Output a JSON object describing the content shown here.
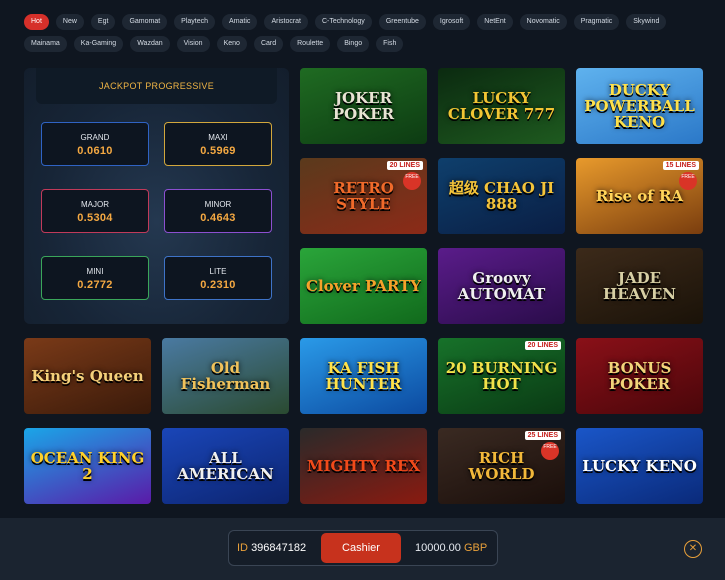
{
  "categories": [
    {
      "label": "Hot",
      "active": true
    },
    {
      "label": "New"
    },
    {
      "label": "Egt"
    },
    {
      "label": "Gamomat"
    },
    {
      "label": "Playtech"
    },
    {
      "label": "Amatic"
    },
    {
      "label": "Aristocrat"
    },
    {
      "label": "C-Technology"
    },
    {
      "label": "Greentube"
    },
    {
      "label": "Igrosoft"
    },
    {
      "label": "NetEnt"
    },
    {
      "label": "Novomatic"
    },
    {
      "label": "Pragmatic"
    },
    {
      "label": "Skywind"
    },
    {
      "label": "Mainama"
    },
    {
      "label": "Ka-Gaming"
    },
    {
      "label": "Wazdan"
    },
    {
      "label": "Vision"
    },
    {
      "label": "Keno"
    },
    {
      "label": "Card"
    },
    {
      "label": "Roulette"
    },
    {
      "label": "Bingo"
    },
    {
      "label": "Fish"
    }
  ],
  "jackpot": {
    "title": "JACKPOT PROGRESSIVE",
    "items": [
      {
        "label": "GRAND",
        "value": "0.0610",
        "border": "#2f63c4"
      },
      {
        "label": "MAXI",
        "value": "0.5969",
        "border": "#d2a73c"
      },
      {
        "label": "MAJOR",
        "value": "0.5304",
        "border": "#c13a5a"
      },
      {
        "label": "MINOR",
        "value": "0.4643",
        "border": "#8c4fd0"
      },
      {
        "label": "MINI",
        "value": "0.2772",
        "border": "#3aa65a"
      },
      {
        "label": "LITE",
        "value": "0.2310",
        "border": "#3e73c8"
      }
    ]
  },
  "games": [
    {
      "name": "JOKER POKER",
      "bg": "linear-gradient(160deg,#1f6b22,#0d3b12)",
      "color": "#e9e4d4"
    },
    {
      "name": "LUCKY CLOVER 777",
      "bg": "linear-gradient(160deg,#0b2a10,#1e5a1f)",
      "color": "#f2c534"
    },
    {
      "name": "DUCKY POWERBALL KENO",
      "bg": "linear-gradient(160deg,#5fb2ee,#2b78c8)",
      "color": "#ffe14a"
    },
    {
      "name": "RETRO STYLE",
      "bg": "linear-gradient(160deg,#5a3a1c,#8c2a18)",
      "color": "#f06a2a",
      "badge": "20 LINES",
      "badge2": "FREE"
    },
    {
      "name": "超级 CHAO JI 888",
      "bg": "linear-gradient(160deg,#0e3f6c,#0a1e44)",
      "color": "#f4c43a"
    },
    {
      "name": "Rise of RA",
      "bg": "linear-gradient(160deg,#e89a2c,#7a3d0e)",
      "color": "#ffd45a",
      "badge": "15 LINES",
      "badge2": "FREE"
    },
    {
      "name": "Clover PARTY",
      "bg": "linear-gradient(160deg,#2aa53a,#116a1c)",
      "color": "#f6a22a"
    },
    {
      "name": "Groovy AUTOMAT",
      "bg": "linear-gradient(160deg,#5a1c8a,#2a0c4a)",
      "color": "#f0f0f0"
    },
    {
      "name": "JADE HEAVEN",
      "bg": "linear-gradient(160deg,#3c2a1a,#1a1208)",
      "color": "#d7cfa4"
    },
    {
      "name": "King's Queen",
      "bg": "linear-gradient(160deg,#7a3a18,#3a1a0a)",
      "color": "#f4d07a"
    },
    {
      "name": "Old Fisherman",
      "bg": "linear-gradient(160deg,#4a7aa2,#2a4a30)",
      "color": "#f0c25a"
    },
    {
      "name": "KA FISH HUNTER",
      "bg": "linear-gradient(160deg,#2a9ae8,#0c4aa0)",
      "color": "#ffe24a"
    },
    {
      "name": "20 BURNING HOT",
      "bg": "linear-gradient(160deg,#17722a,#0a3a14)",
      "color": "#f2e24a",
      "badge": "20 LINES"
    },
    {
      "name": "BONUS POKER",
      "bg": "linear-gradient(160deg,#8a1018,#4a060a)",
      "color": "#f2d47a"
    },
    {
      "name": "OCEAN KING 2",
      "bg": "linear-gradient(160deg,#1aa6e8,#5a1aa8)",
      "color": "#ffd02a"
    },
    {
      "name": "ALL AMERICAN",
      "bg": "linear-gradient(160deg,#1a46b8,#0c2470)",
      "color": "#f0f0f0"
    },
    {
      "name": "MIGHTY REX",
      "bg": "linear-gradient(160deg,#2a2a2a,#8a1a10)",
      "color": "#f24a1a"
    },
    {
      "name": "RICH WORLD",
      "bg": "linear-gradient(160deg,#3a2a22,#1a0e0a)",
      "color": "#f2b83a",
      "badge": "25 LINES",
      "badge2": "FREE"
    },
    {
      "name": "LUCKY KENO",
      "bg": "linear-gradient(160deg,#1a56c8,#0a2a7a)",
      "color": "#ffffff"
    }
  ],
  "wallet": {
    "id_label": "ID",
    "id_value": "396847182",
    "cashier_label": "Cashier",
    "balance": "10000.00",
    "currency": "GBP"
  },
  "close_label": "✕"
}
